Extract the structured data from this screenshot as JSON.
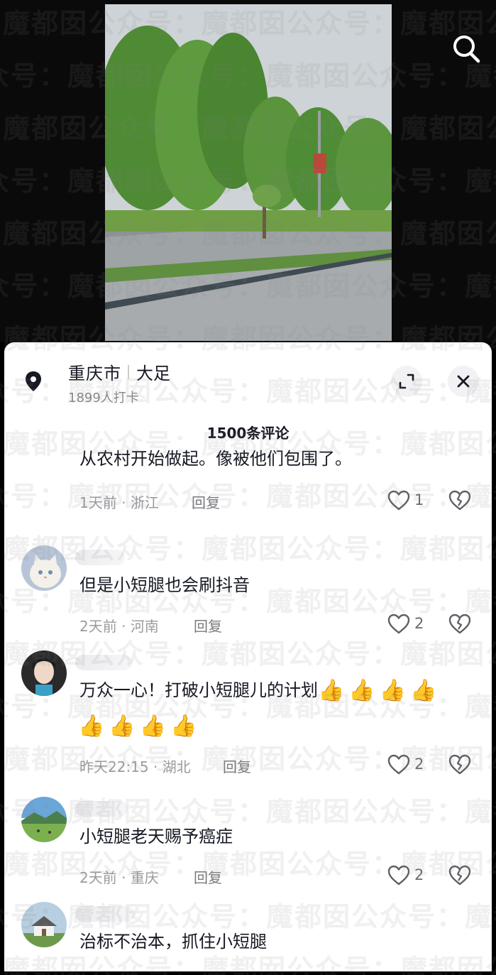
{
  "location": {
    "city": "重庆市",
    "district": "大足",
    "checkins": "1899人打卡"
  },
  "comments_header": "1500条评论",
  "watermark": "魔都囡公众号：",
  "colors": {
    "text": "#161823",
    "meta": "#9a9aa0",
    "icon": "#5f5f66",
    "sheet": "#ffffff"
  },
  "icons": {
    "search": "search-icon",
    "location": "location-pin-icon",
    "expand": "expand-icon",
    "close": "close-icon",
    "like": "heart-icon",
    "dislike": "broken-heart-icon",
    "thumb": "thumbs-up-emoji"
  },
  "comments": [
    {
      "text_lines": [
        "从农村开始做起。像被他们包围了。"
      ],
      "time": "1天前",
      "region": "浙江",
      "reply": "回复",
      "likes": "1"
    },
    {
      "text_lines": [
        "但是小短腿也会刷抖音"
      ],
      "time": "2天前",
      "region": "河南",
      "reply": "回复",
      "likes": "2"
    },
    {
      "text_lines": [
        "万众一心！打破小短腿儿的计划"
      ],
      "thumbs_line1": 4,
      "thumbs_line2": 4,
      "time": "昨天22:15",
      "region": "湖北",
      "reply": "回复",
      "likes": "2"
    },
    {
      "text_lines": [
        "小短腿老天赐予癌症"
      ],
      "time": "2天前",
      "region": "重庆",
      "reply": "回复",
      "likes": "2"
    },
    {
      "text_lines": [
        "治标不治本，抓住小短腿"
      ]
    }
  ]
}
